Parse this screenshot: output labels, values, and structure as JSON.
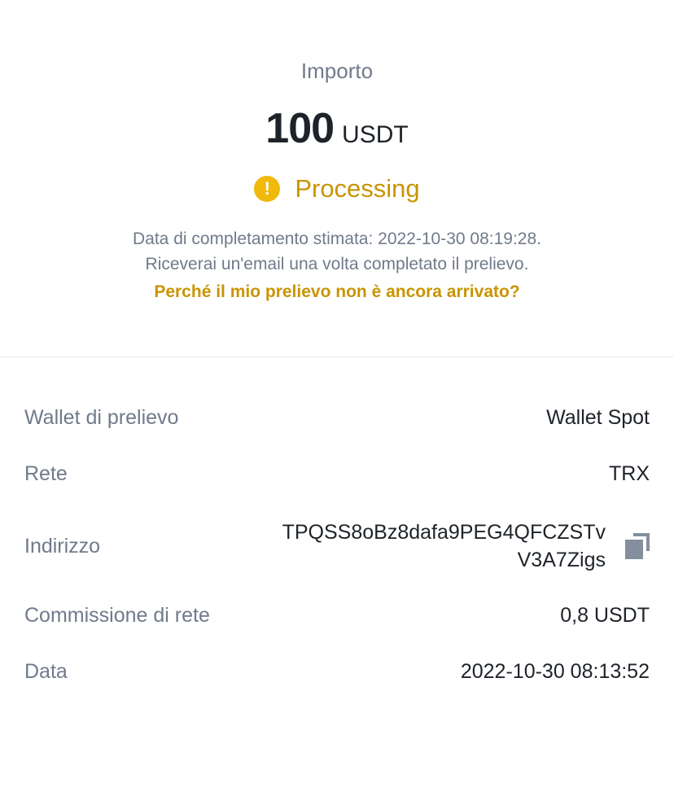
{
  "header": {
    "amount_label": "Importo",
    "amount_value": "100",
    "amount_unit": "USDT",
    "status_icon": "!",
    "status_text": "Processing",
    "info_line_1": "Data di completamento stimata: 2022-10-30 08:19:28.",
    "info_line_2": "Riceverai un'email una volta completato il prelievo.",
    "help_link": "Perché il mio prelievo non è ancora arrivato?"
  },
  "details": {
    "wallet": {
      "label": "Wallet di prelievo",
      "value": "Wallet Spot"
    },
    "network": {
      "label": "Rete",
      "value": "TRX"
    },
    "address": {
      "label": "Indirizzo",
      "value_line_1": "TPQSS8oBz8dafa9PEG4QFCZSTv",
      "value_line_2": "V3A7Zigs"
    },
    "fee": {
      "label": "Commissione di rete",
      "value": "0,8 USDT"
    },
    "date": {
      "label": "Data",
      "value": "2022-10-30 08:13:52"
    }
  },
  "colors": {
    "accent": "#f0b90b",
    "accent_text": "#c99400",
    "secondary_text": "#707a8a",
    "primary_text": "#1e2329"
  }
}
